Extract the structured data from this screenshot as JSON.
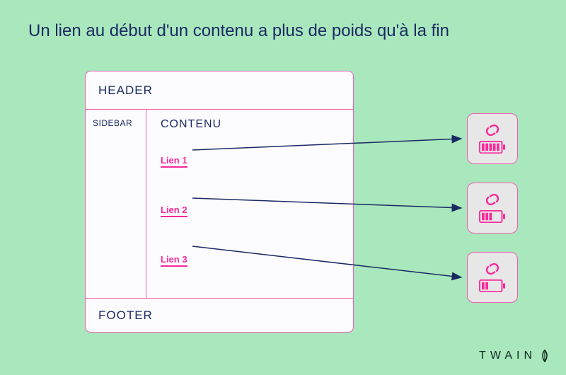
{
  "title": "Un lien au début d'un contenu a plus de poids qu'à la fin",
  "layout": {
    "header": "HEADER",
    "sidebar": "SIDEBAR",
    "content_label": "CONTENU",
    "links": [
      "Lien 1",
      "Lien 2",
      "Lien 3"
    ],
    "footer": "FOOTER"
  },
  "weights": {
    "card1_level": "full",
    "card2_level": "half",
    "card3_level": "low"
  },
  "brand": "TWAIN",
  "colors": {
    "bg": "#a9e7bd",
    "text": "#1b2a63",
    "pink": "#f9299a",
    "border": "#f25db0",
    "card_bg": "#e7e7e7",
    "arrow": "#1b2a63"
  }
}
